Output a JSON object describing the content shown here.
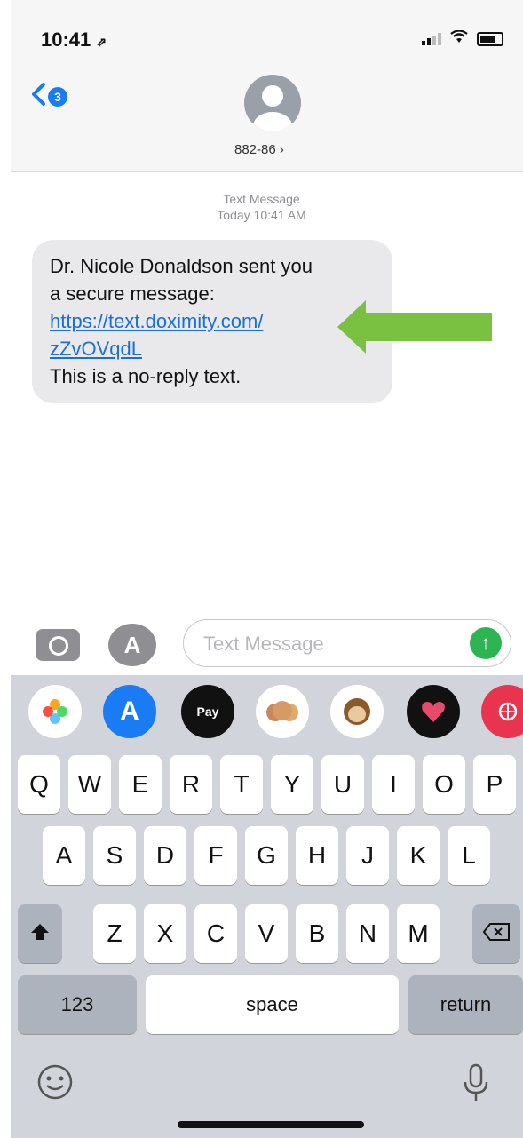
{
  "status": {
    "time": "10:41",
    "location": "⇗"
  },
  "header": {
    "back_count": "3",
    "contact": "882-86 ›"
  },
  "thread": {
    "label": "Text Message",
    "timestamp": "Today 10:41 AM",
    "message_line1": "Dr. Nicole Donaldson sent you",
    "message_line2": "a secure message:",
    "link_line1": "https://text.doximity.com/",
    "link_line2": "zZvOVqdL",
    "message_line3": "This is a no-reply text."
  },
  "compose": {
    "placeholder": "Text Message"
  },
  "app_dock": [
    {
      "icon": "photos-icon"
    },
    {
      "icon": "app-store-icon"
    },
    {
      "icon": "apple-pay-icon",
      "label": "Pay"
    },
    {
      "icon": "memoji-icon"
    },
    {
      "icon": "monkey-animoji-icon"
    },
    {
      "icon": "digital-touch-icon"
    },
    {
      "icon": "web-search-icon"
    }
  ],
  "keyboard": {
    "row1": [
      "Q",
      "W",
      "E",
      "R",
      "T",
      "Y",
      "U",
      "I",
      "O",
      "P"
    ],
    "row2": [
      "A",
      "S",
      "D",
      "F",
      "G",
      "H",
      "J",
      "K",
      "L"
    ],
    "row3": [
      "Z",
      "X",
      "C",
      "V",
      "B",
      "N",
      "M"
    ],
    "numbers_label": "123",
    "space_label": "space",
    "return_label": "return"
  },
  "colors": {
    "accent": "#1a7cf5",
    "arrow": "#7ac142",
    "send": "#2db553"
  }
}
